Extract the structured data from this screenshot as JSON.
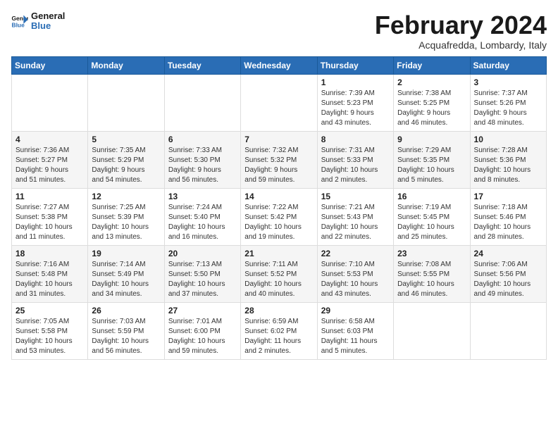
{
  "logo": {
    "line1": "General",
    "line2": "Blue"
  },
  "title": "February 2024",
  "subtitle": "Acquafredda, Lombardy, Italy",
  "weekdays": [
    "Sunday",
    "Monday",
    "Tuesday",
    "Wednesday",
    "Thursday",
    "Friday",
    "Saturday"
  ],
  "weeks": [
    [
      {
        "day": "",
        "info": ""
      },
      {
        "day": "",
        "info": ""
      },
      {
        "day": "",
        "info": ""
      },
      {
        "day": "",
        "info": ""
      },
      {
        "day": "1",
        "info": "Sunrise: 7:39 AM\nSunset: 5:23 PM\nDaylight: 9 hours\nand 43 minutes."
      },
      {
        "day": "2",
        "info": "Sunrise: 7:38 AM\nSunset: 5:25 PM\nDaylight: 9 hours\nand 46 minutes."
      },
      {
        "day": "3",
        "info": "Sunrise: 7:37 AM\nSunset: 5:26 PM\nDaylight: 9 hours\nand 48 minutes."
      }
    ],
    [
      {
        "day": "4",
        "info": "Sunrise: 7:36 AM\nSunset: 5:27 PM\nDaylight: 9 hours\nand 51 minutes."
      },
      {
        "day": "5",
        "info": "Sunrise: 7:35 AM\nSunset: 5:29 PM\nDaylight: 9 hours\nand 54 minutes."
      },
      {
        "day": "6",
        "info": "Sunrise: 7:33 AM\nSunset: 5:30 PM\nDaylight: 9 hours\nand 56 minutes."
      },
      {
        "day": "7",
        "info": "Sunrise: 7:32 AM\nSunset: 5:32 PM\nDaylight: 9 hours\nand 59 minutes."
      },
      {
        "day": "8",
        "info": "Sunrise: 7:31 AM\nSunset: 5:33 PM\nDaylight: 10 hours\nand 2 minutes."
      },
      {
        "day": "9",
        "info": "Sunrise: 7:29 AM\nSunset: 5:35 PM\nDaylight: 10 hours\nand 5 minutes."
      },
      {
        "day": "10",
        "info": "Sunrise: 7:28 AM\nSunset: 5:36 PM\nDaylight: 10 hours\nand 8 minutes."
      }
    ],
    [
      {
        "day": "11",
        "info": "Sunrise: 7:27 AM\nSunset: 5:38 PM\nDaylight: 10 hours\nand 11 minutes."
      },
      {
        "day": "12",
        "info": "Sunrise: 7:25 AM\nSunset: 5:39 PM\nDaylight: 10 hours\nand 13 minutes."
      },
      {
        "day": "13",
        "info": "Sunrise: 7:24 AM\nSunset: 5:40 PM\nDaylight: 10 hours\nand 16 minutes."
      },
      {
        "day": "14",
        "info": "Sunrise: 7:22 AM\nSunset: 5:42 PM\nDaylight: 10 hours\nand 19 minutes."
      },
      {
        "day": "15",
        "info": "Sunrise: 7:21 AM\nSunset: 5:43 PM\nDaylight: 10 hours\nand 22 minutes."
      },
      {
        "day": "16",
        "info": "Sunrise: 7:19 AM\nSunset: 5:45 PM\nDaylight: 10 hours\nand 25 minutes."
      },
      {
        "day": "17",
        "info": "Sunrise: 7:18 AM\nSunset: 5:46 PM\nDaylight: 10 hours\nand 28 minutes."
      }
    ],
    [
      {
        "day": "18",
        "info": "Sunrise: 7:16 AM\nSunset: 5:48 PM\nDaylight: 10 hours\nand 31 minutes."
      },
      {
        "day": "19",
        "info": "Sunrise: 7:14 AM\nSunset: 5:49 PM\nDaylight: 10 hours\nand 34 minutes."
      },
      {
        "day": "20",
        "info": "Sunrise: 7:13 AM\nSunset: 5:50 PM\nDaylight: 10 hours\nand 37 minutes."
      },
      {
        "day": "21",
        "info": "Sunrise: 7:11 AM\nSunset: 5:52 PM\nDaylight: 10 hours\nand 40 minutes."
      },
      {
        "day": "22",
        "info": "Sunrise: 7:10 AM\nSunset: 5:53 PM\nDaylight: 10 hours\nand 43 minutes."
      },
      {
        "day": "23",
        "info": "Sunrise: 7:08 AM\nSunset: 5:55 PM\nDaylight: 10 hours\nand 46 minutes."
      },
      {
        "day": "24",
        "info": "Sunrise: 7:06 AM\nSunset: 5:56 PM\nDaylight: 10 hours\nand 49 minutes."
      }
    ],
    [
      {
        "day": "25",
        "info": "Sunrise: 7:05 AM\nSunset: 5:58 PM\nDaylight: 10 hours\nand 53 minutes."
      },
      {
        "day": "26",
        "info": "Sunrise: 7:03 AM\nSunset: 5:59 PM\nDaylight: 10 hours\nand 56 minutes."
      },
      {
        "day": "27",
        "info": "Sunrise: 7:01 AM\nSunset: 6:00 PM\nDaylight: 10 hours\nand 59 minutes."
      },
      {
        "day": "28",
        "info": "Sunrise: 6:59 AM\nSunset: 6:02 PM\nDaylight: 11 hours\nand 2 minutes."
      },
      {
        "day": "29",
        "info": "Sunrise: 6:58 AM\nSunset: 6:03 PM\nDaylight: 11 hours\nand 5 minutes."
      },
      {
        "day": "",
        "info": ""
      },
      {
        "day": "",
        "info": ""
      }
    ]
  ]
}
